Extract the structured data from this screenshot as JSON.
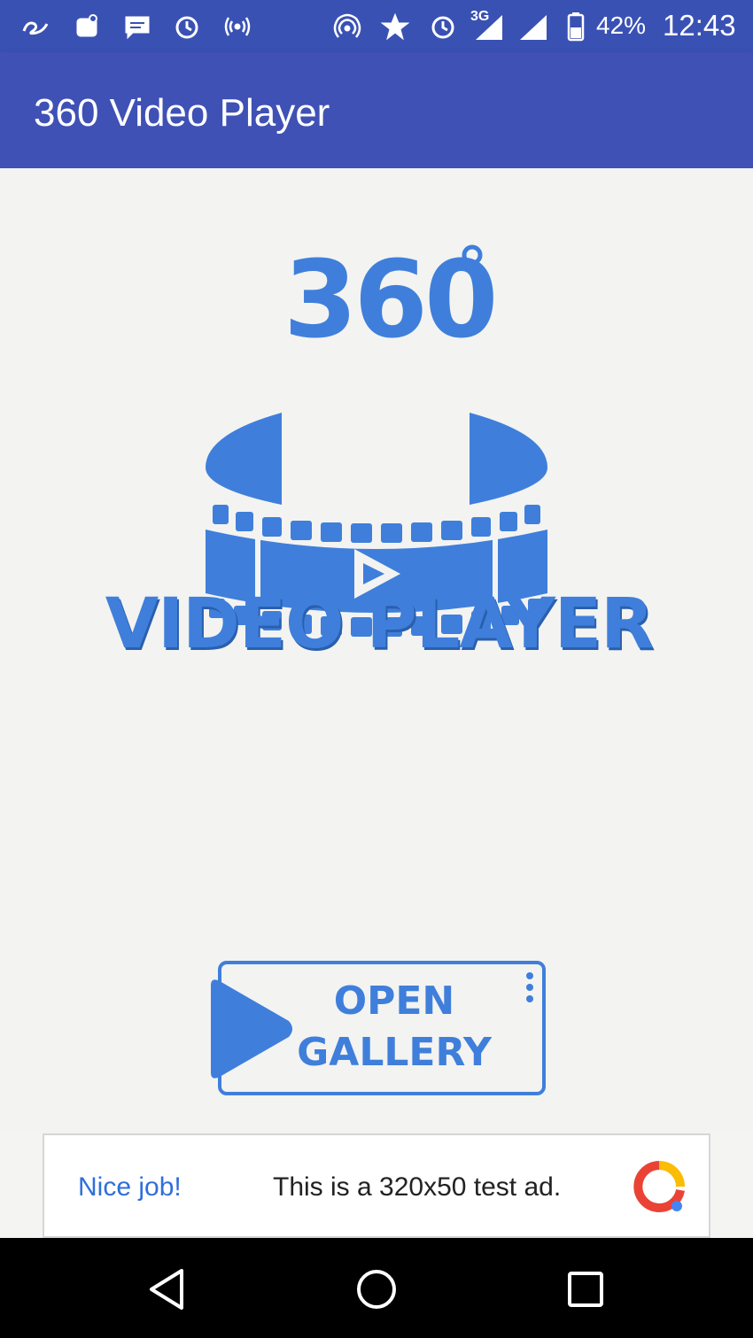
{
  "status_bar": {
    "battery_percent": "42%",
    "time": "12:43",
    "network_label": "3G",
    "icons": [
      "app-icon",
      "settings-sparkle-icon",
      "message-icon",
      "alarm-icon",
      "wireless-icon",
      "hotspot-icon",
      "star-icon",
      "alarm-icon",
      "signal-3g-icon",
      "signal-icon",
      "battery-icon"
    ]
  },
  "app_bar": {
    "title": "360 Video Player"
  },
  "logo": {
    "number": "360",
    "degree": "°",
    "wordmark": "VIDEO PLAYER"
  },
  "open_gallery": {
    "line1": "OPEN",
    "line2": "GALLERY"
  },
  "ad": {
    "title": "Nice job!",
    "body": "This is a 320x50 test ad."
  },
  "nav_bar": {
    "buttons": [
      "back-icon",
      "home-icon",
      "recents-icon"
    ]
  },
  "colors": {
    "primary": "#3f51b5",
    "status": "#3a51b4",
    "brand_blue": "#3f7fdb",
    "ad_title": "#2f6fd8"
  }
}
